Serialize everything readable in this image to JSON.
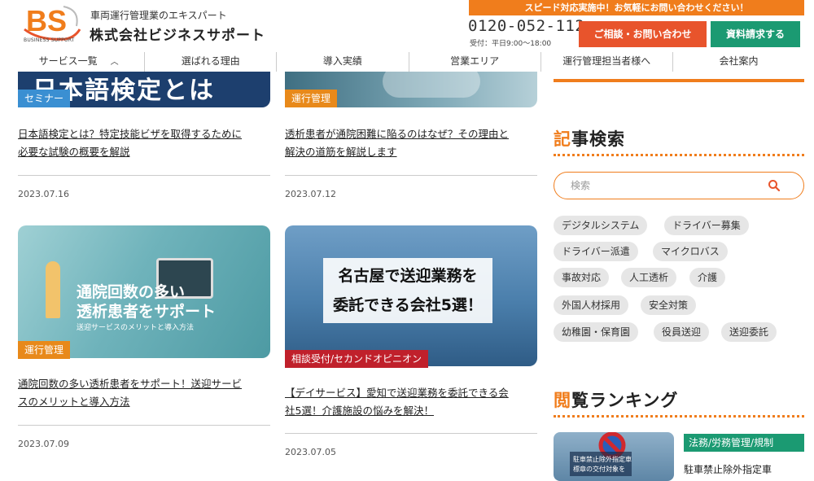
{
  "header": {
    "logo_text": "BS",
    "logo_sub": "BUSINESS SUPPORT",
    "tagline": "車両運行管理業のエキスパート",
    "company_name": "株式会社ビジネスサポート",
    "banner": "スピード対応実施中！お気軽にお問い合わせください！",
    "phone": "0120-052-112",
    "hours": "受付：平日9:00〜18:00",
    "contact_button": "ご相談・お問い合わせ",
    "docs_button": "資料請求する"
  },
  "nav": {
    "items": [
      {
        "label": "サービス一覧"
      },
      {
        "label": "選ばれる理由"
      },
      {
        "label": "導入実績"
      },
      {
        "label": "営業エリア"
      },
      {
        "label": "運行管理担当者様へ"
      },
      {
        "label": "会社案内"
      }
    ]
  },
  "posts": [
    {
      "thumb_text": "日本語検定とは",
      "category": "セミナー",
      "title_line1": "日本語検定とは？特定技能ビザを取得するために",
      "title_line2": "必要な試験の概要を解説",
      "date": "2023.07.16"
    },
    {
      "category": "運行管理",
      "title_line1": "透析患者が通院困難に陥るのはなぜ？その理由と",
      "title_line2": "解決の道筋を解説します",
      "date": "2023.07.12"
    },
    {
      "thumb_line1": "通院回数の多い",
      "thumb_line2": "透析患者をサポート",
      "thumb_sub": "送迎サービスのメリットと導入方法",
      "category": "運行管理",
      "title_line1": "通院回数の多い透析患者をサポート！送迎サービ",
      "title_line2": "スのメリットと導入方法",
      "date": "2023.07.09"
    },
    {
      "thumb_line1": "名古屋で送迎業務を",
      "thumb_line2": "委託できる会社5選！",
      "category": "相談受付/セカンドオピニオン",
      "title_line1": "【デイサービス】愛知で送迎業務を委託できる会",
      "title_line2": "社5選！介護施設の悩みを解決！",
      "date": "2023.07.05"
    }
  ],
  "sidebar": {
    "search_heading_first": "記",
    "search_heading_rest": "事検索",
    "search_placeholder": "検索",
    "tags": [
      "デジタルシステム",
      "ドライバー募集",
      "ドライバー派遣",
      "マイクロバス",
      "事故対応",
      "人工透析",
      "介護",
      "外国人材採用",
      "安全対策",
      "幼稚園・保育園",
      "役員送迎",
      "送迎委託"
    ],
    "ranking_heading_first": "閲",
    "ranking_heading_rest": "覧ランキング",
    "ranking_item": {
      "category": "法務/労務管理/規制",
      "title": "駐車禁止除外指定車",
      "thumb_text1": "駐車禁止除外指定車",
      "thumb_text2": "標章の交付対象を"
    }
  },
  "colors": {
    "brand_orange": "#f07d1c",
    "contact_red": "#e8542c",
    "docs_green": "#1b9a72",
    "tag_blue": "#3a8fd2",
    "tag_orange": "#e8891a",
    "tag_red": "#c0202b"
  }
}
